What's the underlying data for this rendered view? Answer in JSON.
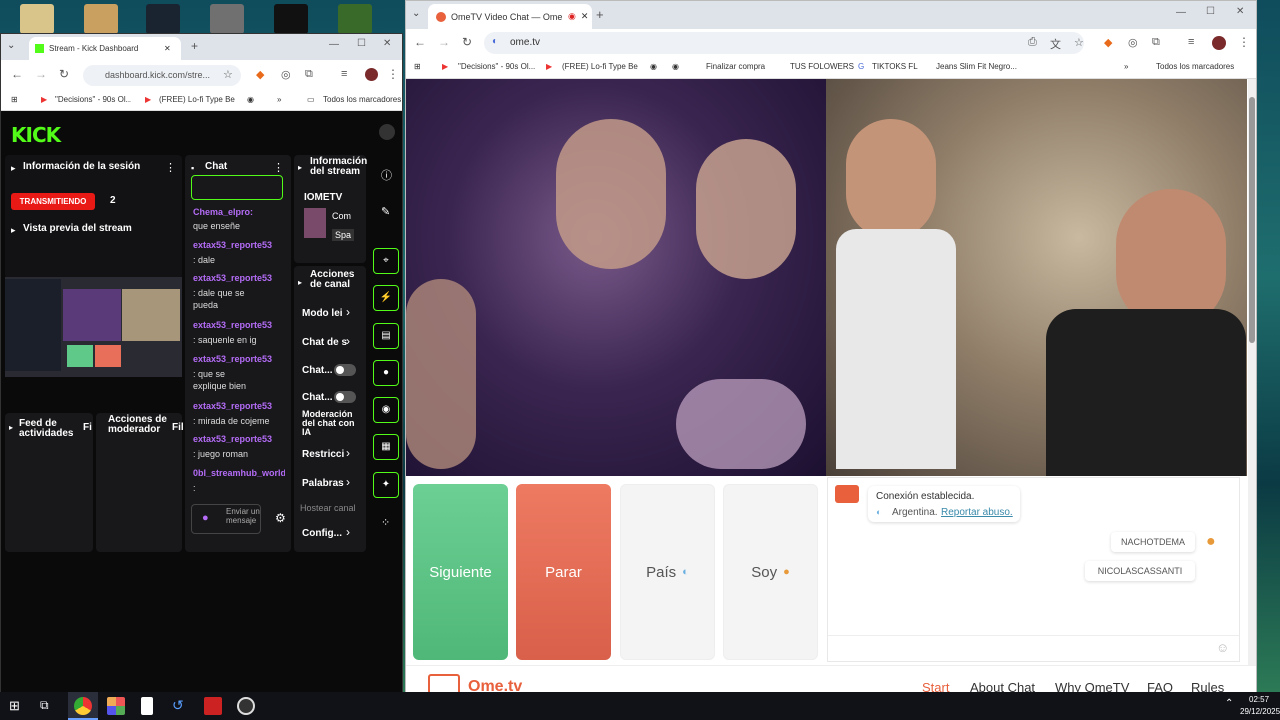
{
  "left_window": {
    "tab_title": "Stream - Kick Dashboard",
    "url": "dashboard.kick.com/stre...",
    "bookmarks": [
      "\"Decisions\" - 90s Ol...",
      "(FREE) Lo-fi Type Be...",
      "Todos los marcadores"
    ],
    "logo": "KICK",
    "session_panel": {
      "title": "Información de la sesión",
      "status_badge": "TRANSMITIENDO",
      "viewers": "2",
      "preview_title": "Vista previa del stream"
    },
    "chat_panel": {
      "title": "Chat",
      "messages": [
        {
          "user": "Chema_elpro:",
          "text": "que enseñe"
        },
        {
          "user": "extax53_reporte53",
          "text": ": dale"
        },
        {
          "user": "extax53_reporte53",
          "text": ": dale que se pueda"
        },
        {
          "user": "extax53_reporte53",
          "text": ": saquenle en ig"
        },
        {
          "user": "extax53_reporte53",
          "text": ": que se explique bien"
        },
        {
          "user": "extax53_reporte53",
          "text": ": mirada de cojeme"
        },
        {
          "user": "extax53_reporte53",
          "text": ": juego roman"
        },
        {
          "user": "0bl_streamhub_world",
          "text": ":"
        }
      ],
      "input_placeholder": "Enviar un mensaje"
    },
    "stream_info_panel": {
      "title": "Información del stream",
      "stream_name": "IOMETV",
      "line1": "Com",
      "line2": "Spa"
    },
    "actions_panel": {
      "title": "Acciones de canal",
      "items": [
        "Modo lei",
        "Chat de s",
        "Chat...",
        "Chat...",
        "Moderación del chat con IA",
        "Restricci",
        "Palabras",
        "Config..."
      ],
      "host_placeholder": "Hostear canal"
    },
    "feed_panel": {
      "title": "Feed de actividades",
      "filter": "Fi"
    },
    "mod_panel": {
      "title": "Acciones de moderador",
      "filter": "Fil"
    }
  },
  "right_window": {
    "tab_title": "OmeTV Video Chat — Ome",
    "url": "ome.tv",
    "bookmarks": [
      "\"Decisions\" - 90s Ol...",
      "(FREE) Lo-fi Type Be...",
      "Finalizar compra",
      "TUS FOLOWERS",
      "TIKTOKS FL",
      "Jeans Slim Fit Negro...",
      "Todos los marcadores"
    ],
    "buttons": {
      "next": "Siguiente",
      "stop": "Parar",
      "country": "País",
      "gender": "Soy"
    },
    "chat": {
      "status": "Conexión establecida.",
      "country": "Argentina.",
      "report": "Reportar abuso.",
      "tags": [
        "NACHOTDEMA",
        "NICOLASCASSANTI"
      ]
    },
    "footer": {
      "logo": "Ome.tv",
      "links": [
        "Start",
        "About Chat",
        "Why OmeTV",
        "FAQ",
        "Rules"
      ]
    }
  },
  "taskbar": {
    "time": "02:57",
    "date": "29/12/2025"
  },
  "colors": {
    "kick_green": "#53fc18",
    "next_green": "#5fc98a",
    "stop_red": "#e8705a",
    "ome_orange": "#e8603c"
  }
}
